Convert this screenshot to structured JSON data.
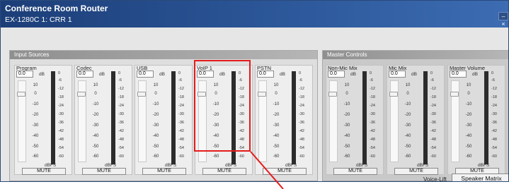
{
  "window": {
    "app_title": "Conference Room Router",
    "device_title": "EX-1280C 1: CRR 1",
    "close_glyph": "– ×"
  },
  "input_sources": {
    "header": "Input Sources",
    "strips": [
      {
        "name": "Program",
        "level": "0.0",
        "unit": "dB",
        "mute": "MUTE"
      },
      {
        "name": "Codec",
        "level": "0.0",
        "unit": "dB",
        "mute": "MUTE"
      },
      {
        "name": "USB",
        "level": "0.0",
        "unit": "dB",
        "mute": "MUTE"
      },
      {
        "name": "VoIP 1",
        "level": "0.0",
        "unit": "dB",
        "mute": "MUTE"
      },
      {
        "name": "PSTN",
        "level": "0.0",
        "unit": "dB",
        "mute": "MUTE"
      }
    ]
  },
  "master_controls": {
    "header": "Master Controls",
    "strips": [
      {
        "name": "Non-Mic Mix",
        "level": "0.0",
        "unit": "dB",
        "mute": "MUTE"
      },
      {
        "name": "Mic Mix",
        "level": "0.0",
        "unit": "dB",
        "mute": "MUTE"
      },
      {
        "name": "Master Volume",
        "level": "0.0",
        "unit": "dB",
        "mute": "MUTE"
      }
    ]
  },
  "fader_scale": [
    "10",
    "0",
    "-10",
    "-20",
    "-30",
    "-40",
    "-50",
    "-60"
  ],
  "meter_scale": [
    "0",
    "-6",
    "-12",
    "-18",
    "-24",
    "-30",
    "-36",
    "-42",
    "-48",
    "-54",
    "-60"
  ],
  "meter_unit": "dBFS",
  "footer": {
    "voice_lift": "Voice-Lift",
    "speaker_matrix": "Speaker Matrix"
  },
  "colors": {
    "title_bar": "#2c5799",
    "highlight": "#e51b1b",
    "meter": "#2c2c2c"
  }
}
